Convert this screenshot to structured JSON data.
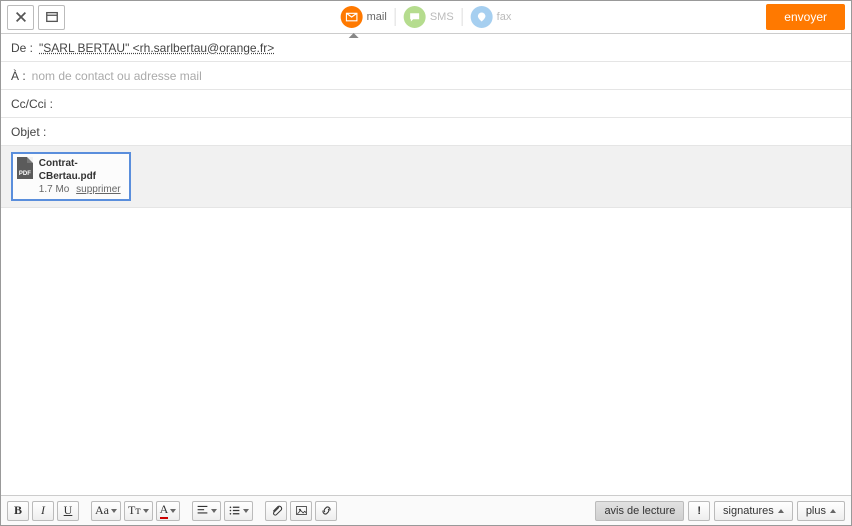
{
  "topbar": {
    "channels": {
      "mail": "mail",
      "sms": "SMS",
      "fax": "fax"
    },
    "send": "envoyer"
  },
  "fields": {
    "from_label": "De :",
    "from_value": "\"SARL BERTAU\" <rh.sarlbertau@orange.fr>",
    "to_label": "À :",
    "to_placeholder": "nom de contact ou adresse mail",
    "cc_label": "Cc/Cci :",
    "subject_label": "Objet :"
  },
  "attachment": {
    "badge": "PDF",
    "name": "Contrat-CBertau.pdf",
    "size": "1.7 Mo",
    "delete": "supprimer"
  },
  "toolbar": {
    "bold": "B",
    "italic": "I",
    "underline": "U",
    "fontsize": "Aa",
    "fontfamily": "Tᴛ",
    "fontcolor": "A",
    "read_receipt": "avis de lecture",
    "priority": "!",
    "signatures": "signatures",
    "more": "plus"
  }
}
